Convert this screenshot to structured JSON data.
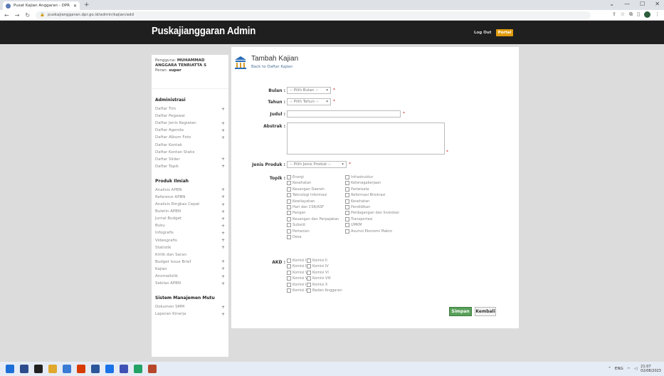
{
  "browser": {
    "tab_title": "Pusat Kajian Anggaran - DPR RI",
    "url": "puskajianggaran.dpr.go.id/admin/kajian/add",
    "win_controls": [
      "⌄",
      "—",
      "☐",
      "✕"
    ]
  },
  "header": {
    "brand": "Puskajianggaran Admin",
    "logout_label": "Log Out",
    "portal_label": "Portal"
  },
  "sidebar": {
    "user_label": "Pengguna:",
    "user_name": "MUHAMMAD ANGGARA TENRIATTA S",
    "role_label": "Peran:",
    "role": "super",
    "sections": [
      {
        "title": "Administrasi",
        "items": [
          {
            "label": "Daftar Tim",
            "plus": "+"
          },
          {
            "label": "Daftar Pegawai",
            "plus": ""
          },
          {
            "label": "Daftar Jenis Kegiatan",
            "plus": "+"
          },
          {
            "label": "Daftar Agenda",
            "plus": "+"
          },
          {
            "label": "Daftar Album Foto",
            "plus": "+"
          },
          {
            "label": "Daftar Kontak",
            "plus": ""
          },
          {
            "label": "Daftar Kontan Statis",
            "plus": ""
          },
          {
            "label": "Daftar Slider",
            "plus": "+"
          },
          {
            "label": "Daftar Topik",
            "plus": "+"
          }
        ]
      },
      {
        "title": "Produk Ilmiah",
        "items": [
          {
            "label": "Analisis APBN",
            "plus": "+"
          },
          {
            "label": "Referensi APBN",
            "plus": "+"
          },
          {
            "label": "Analisis Ringkas Cepat",
            "plus": "+"
          },
          {
            "label": "Buletin APBN",
            "plus": "+"
          },
          {
            "label": "Jurnal Budget",
            "plus": "+"
          },
          {
            "label": "Buku",
            "plus": "+"
          },
          {
            "label": "Infografis",
            "plus": "+"
          },
          {
            "label": "Videografis",
            "plus": "+"
          },
          {
            "label": "Statistik",
            "plus": "+"
          },
          {
            "label": "Kritik dan Saran",
            "plus": ""
          },
          {
            "label": "Budget Issue Brief",
            "plus": "+"
          },
          {
            "label": "Kajian",
            "plus": "+"
          },
          {
            "label": "Anomalistik",
            "plus": "+"
          },
          {
            "label": "Sekilas APBN",
            "plus": "+"
          }
        ]
      },
      {
        "title": "Sistem Manajemen Mutu",
        "items": [
          {
            "label": "Dokumen SMM",
            "plus": "+"
          },
          {
            "label": "Laporan Kinerja",
            "plus": "+"
          }
        ]
      }
    ]
  },
  "main": {
    "title": "Tambah Kajian",
    "back_link": "Back to Daftar Kajian",
    "form": {
      "bulan_label": "Bulan :",
      "bulan_value": "-- Pilih Bulan --",
      "tahun_label": "Tahun :",
      "tahun_value": "-- Pilih Tahun --",
      "judul_label": "Judul :",
      "abstrak_label": "Abstrak :",
      "jenis_label": "Jenis Produk :",
      "jenis_value": "-- Pilih Jenis Produk --",
      "topik_label": "Topik :",
      "akd_label": "AKD :",
      "required_mark": "*",
      "topics_left": [
        "Energi",
        "Kesehatan",
        "Keuangan Daerah",
        "Teknologi Informasi",
        "Kewilayahan",
        "Hari dan CSR/ASF",
        "Pangan",
        "Keuangan dan Perpajakan",
        "Subsidi",
        "Pertanian",
        "Desa"
      ],
      "topics_right": [
        "Infrastruktur",
        "Ketenagakerjaan",
        "Pariwisata",
        "Reformasi Birokrasi",
        "Kesehatan",
        "Pendidikan",
        "Perdagangan dan Investasi",
        "Transportasi",
        "UMKM",
        "Asumsi Ekonomi Makro"
      ],
      "akd_rows": [
        [
          "Komisi I",
          "Komisi II"
        ],
        [
          "Komisi III",
          "Komisi IV"
        ],
        [
          "Komisi V",
          "Komisi VI"
        ],
        [
          "Komisi VII",
          "Komisi VIII"
        ],
        [
          "Komisi IX",
          "Komisi X"
        ],
        [
          "Komisi XI",
          "Badan Anggaran"
        ]
      ],
      "save_label": "Simpan",
      "back_label": "Kembali"
    }
  },
  "taskbar": {
    "tray_lang": "ENG",
    "tray_time": "21:07",
    "tray_date": "02/08/2023"
  },
  "colors": {
    "header_bg": "#1f1f1f",
    "portal": "#e09c0f",
    "save_btn": "#58a05a",
    "icon_blue": "#2a6ab6"
  }
}
